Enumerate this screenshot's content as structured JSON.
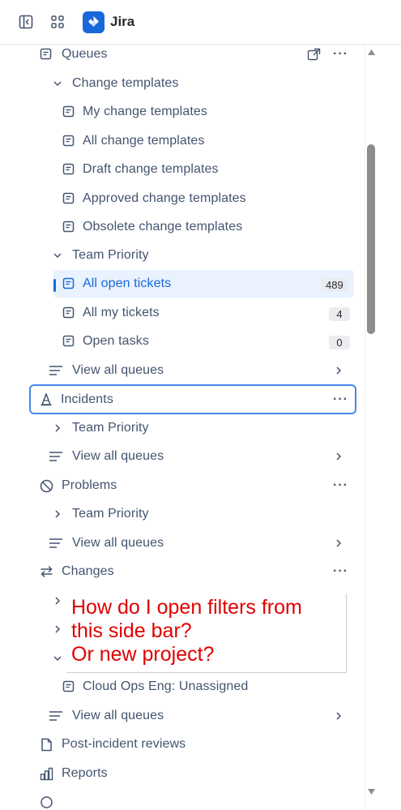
{
  "header": {
    "app_title": "Jira"
  },
  "sidebar": {
    "queues": {
      "label": "Queues",
      "change_templates": {
        "label": "Change templates",
        "items": [
          "My change templates",
          "All change templates",
          "Draft change templates",
          "Approved change templates",
          "Obsolete change templates"
        ]
      },
      "team_priority": {
        "label": "Team Priority",
        "items": [
          {
            "label": "All open tickets",
            "count": "489"
          },
          {
            "label": "All my tickets",
            "count": "4"
          },
          {
            "label": "Open tasks",
            "count": "0"
          }
        ]
      },
      "view_all": "View all queues"
    },
    "incidents": {
      "label": "Incidents",
      "team_priority": "Team Priority",
      "view_all": "View all queues"
    },
    "problems": {
      "label": "Problems",
      "team_priority": "Team Priority",
      "view_all": "View all queues"
    },
    "changes": {
      "label": "Changes",
      "sub_item": "Cloud Ops Eng: Unassigned",
      "view_all": "View all queues"
    },
    "post_incident_reviews": "Post-incident reviews",
    "reports": "Reports",
    "more_dots": "···"
  },
  "annotation": {
    "lines": [
      "How do I open filters from",
      "this side bar?",
      "Or new project?"
    ],
    "color": "#e00000"
  },
  "colors": {
    "accent": "#1868db",
    "selected_bg": "#e9f2fe",
    "focus_border": "#4688ec"
  }
}
